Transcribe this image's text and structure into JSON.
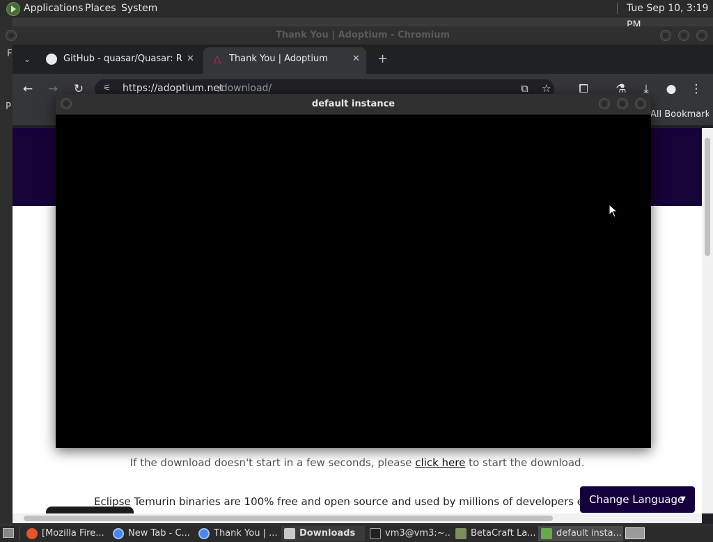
{
  "top_panel": {
    "menus": [
      "Applications",
      "Places",
      "System"
    ],
    "clock": "Tue Sep 10,  3:19 PM"
  },
  "background_window": {
    "edge_letters": [
      "F",
      "P"
    ]
  },
  "chromium": {
    "title": "Thank You | Adoptium - Chromium",
    "tabs": [
      {
        "label": "GitHub - quasar/Quasar: Rem",
        "icon": "github-icon"
      },
      {
        "label": "Thank You | Adoptium",
        "icon": "adoptium-icon"
      }
    ],
    "url": {
      "host": "https://adoptium.net",
      "path": "/download/"
    },
    "bookmarks_label": "All Bookmarks",
    "page": {
      "download_prefix": "If the download doesn't start in a few seconds, please ",
      "download_link": "click here",
      "download_suffix": " to start the download.",
      "temurin_line": "Eclipse Temurin binaries are 100% free and open source and used by millions of developers every d",
      "change_language": "Change Language"
    }
  },
  "instance_window": {
    "title": "default instance"
  },
  "taskbar": {
    "items": [
      {
        "label": "[Mozilla Fire...",
        "icon": "firefox-icon"
      },
      {
        "label": "New Tab - C...",
        "icon": "chromium-icon"
      },
      {
        "label": "Thank You | ...",
        "icon": "chromium-icon"
      },
      {
        "label": "Downloads",
        "icon": "folder-icon"
      },
      {
        "label": "vm3@vm3:~...",
        "icon": "terminal-icon"
      },
      {
        "label": "BetaCraft La...",
        "icon": "betacraft-icon"
      },
      {
        "label": "default insta...",
        "icon": "minecraft-icon"
      }
    ]
  },
  "colors": {
    "hero": "#16033a",
    "change_language_bg": "#14003c",
    "adoptium_pink": "#ff1464"
  }
}
